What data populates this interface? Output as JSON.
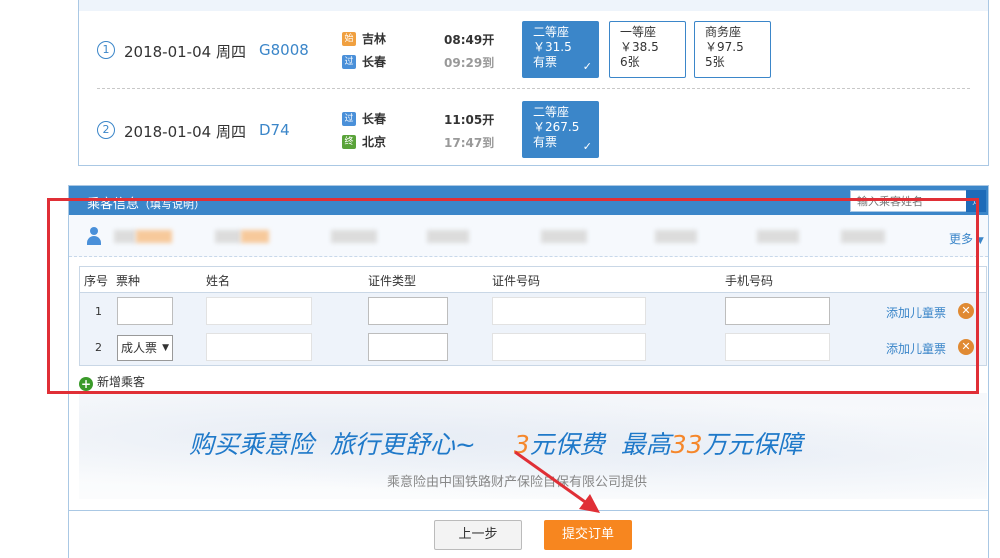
{
  "trips": [
    {
      "seq": "1",
      "date": "2018-01-04 周四",
      "train": "G8008",
      "from": {
        "badge": "始",
        "name": "吉林"
      },
      "to": {
        "badge": "过",
        "name": "长春"
      },
      "depart": "08:49开",
      "arrive": "09:29到",
      "seats": [
        {
          "class": "二等座",
          "price": "￥31.5",
          "avail": "有票",
          "selected": true
        },
        {
          "class": "一等座",
          "price": "￥38.5",
          "avail": "6张",
          "selected": false
        },
        {
          "class": "商务座",
          "price": "￥97.5",
          "avail": "5张",
          "selected": false
        }
      ]
    },
    {
      "seq": "2",
      "date": "2018-01-04 周四",
      "train": "D74",
      "from": {
        "badge": "过",
        "name": "长春"
      },
      "to": {
        "badge": "终",
        "name": "北京"
      },
      "depart": "11:05开",
      "arrive": "17:47到",
      "seats": [
        {
          "class": "二等座",
          "price": "￥267.5",
          "avail": "有票",
          "selected": true
        }
      ]
    }
  ],
  "passenger": {
    "title": "乘客信息",
    "title_sub": "（填写说明）",
    "search_placeholder": "输入乘客姓名",
    "more": "更多",
    "columns": [
      "序号",
      "票种",
      "姓名",
      "证件类型",
      "证件号码",
      "手机号码"
    ],
    "rows": [
      {
        "no": "1",
        "ticket_type": "",
        "add_child": "添加儿童票"
      },
      {
        "no": "2",
        "ticket_type": "成人票",
        "add_child": "添加儿童票"
      }
    ],
    "add_passenger": "新增乘客"
  },
  "insurance": {
    "part1": "购买乘意险",
    "part2": "旅行更舒心~",
    "part3_num": "3",
    "part3_text": "元保费",
    "part4_pre": "最高",
    "part4_num": "33",
    "part4_post": "万元保障",
    "provider": "乘意险由中国铁路财产保险自保有限公司提供"
  },
  "actions": {
    "prev": "上一步",
    "submit": "提交订单"
  },
  "colors": {
    "brand_blue": "#3b86c9",
    "submit_orange": "#f7861f",
    "highlight_red": "#e02f36"
  }
}
